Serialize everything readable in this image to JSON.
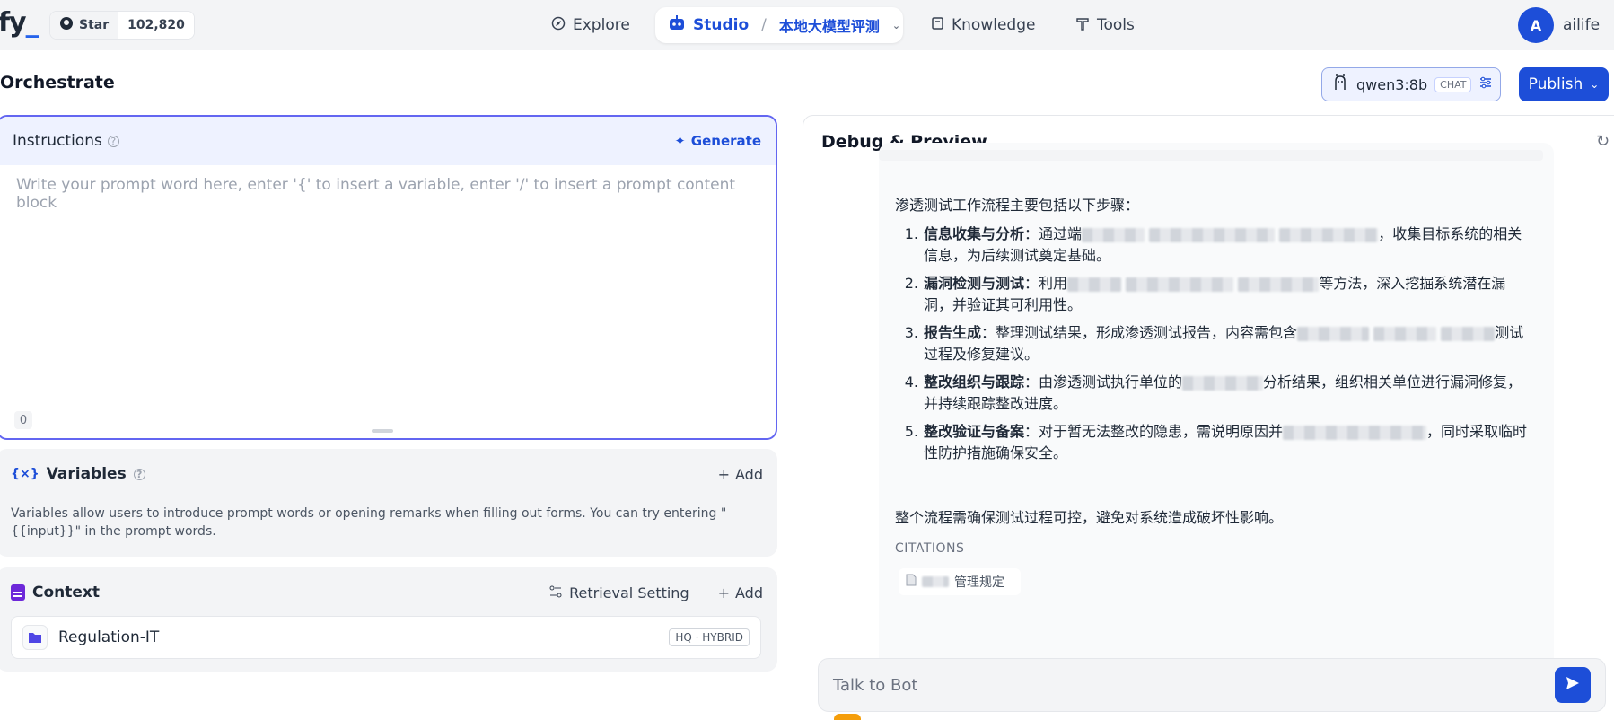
{
  "topbar": {
    "logo": "fy",
    "star_label": "Star",
    "star_count": "102,820",
    "nav": {
      "explore": "Explore",
      "studio": "Studio",
      "app_name": "本地大模型评测",
      "knowledge": "Knowledge",
      "tools": "Tools"
    },
    "user": {
      "initial": "A",
      "name": "ailife"
    }
  },
  "page": {
    "title": "Orchestrate",
    "model": {
      "name": "qwen3:8b",
      "tag": "CHAT"
    },
    "publish_label": "Publish"
  },
  "instructions": {
    "title": "Instructions",
    "generate_label": "Generate",
    "placeholder": "Write your prompt word here, enter '{' to insert a variable, enter '/' to insert a prompt content block",
    "char_count": "0"
  },
  "variables": {
    "title": "Variables",
    "add_label": "Add",
    "description": "Variables allow users to introduce prompt words or opening remarks when filling out forms. You can try entering \"{{input}}\" in the prompt words."
  },
  "context": {
    "title": "Context",
    "retrieval_label": "Retrieval Setting",
    "add_label": "Add",
    "dataset": {
      "name": "Regulation-IT",
      "badge": "HQ · HYBRID"
    }
  },
  "debug": {
    "title": "Debug & Preview",
    "answer": {
      "intro": "渗透测试工作流程主要包括以下步骤：",
      "steps": [
        {
          "num": "1.",
          "title": "信息收集与分析",
          "pre": "：通过端",
          "post": "，收集目标系统的相关信息，为后续测试奠定基础。"
        },
        {
          "num": "2.",
          "title": "漏洞检测与测试",
          "pre": "：利用",
          "post": "等方法，深入挖掘系统潜在漏洞，并验证其可利用性。"
        },
        {
          "num": "3.",
          "title": "报告生成",
          "pre": "：整理测试结果，形成渗透测试报告，内容需包含",
          "post": "测试过程及修复建议。"
        },
        {
          "num": "4.",
          "title": "整改组织与跟踪",
          "pre": "：由渗透测试执行单位的",
          "post": "分析结果，组织相关单位进行漏洞修复，并持续跟踪整改进度。"
        },
        {
          "num": "5.",
          "title": "整改验证与备案",
          "pre": "：对于暂无法整改的隐患，需说明原因并",
          "post": "，同时采取临时性防护措施确保安全。"
        }
      ],
      "outro": "整个流程需确保测试过程可控，避免对系统造成破坏性影响。",
      "citations_label": "CITATIONS",
      "citation_item": "管理规定"
    },
    "input_placeholder": "Talk to Bot"
  }
}
